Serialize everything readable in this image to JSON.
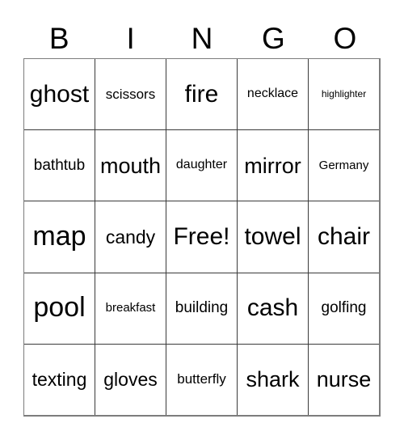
{
  "card": {
    "title": "BINGO",
    "header_letters": [
      "B",
      "I",
      "N",
      "G",
      "O"
    ],
    "free_space": "Free!",
    "colors": {
      "background": "#ffffff",
      "text": "#000000",
      "outer_border": "#7d7d7d",
      "inner_border": "#3a3a3a"
    },
    "rows": [
      [
        {
          "label": "ghost",
          "size": "s-xxl"
        },
        {
          "label": "scissors",
          "size": "s-md"
        },
        {
          "label": "fire",
          "size": "s-xxl"
        },
        {
          "label": "necklace",
          "size": "s-smm"
        },
        {
          "label": "highlighter",
          "size": "s-xs"
        }
      ],
      [
        {
          "label": "bathtub",
          "size": "s-mdl"
        },
        {
          "label": "mouth",
          "size": "s-xl"
        },
        {
          "label": "daughter",
          "size": "s-smm"
        },
        {
          "label": "mirror",
          "size": "s-xl"
        },
        {
          "label": "Germany",
          "size": "s-sm"
        }
      ],
      [
        {
          "label": "map",
          "size": "s-max"
        },
        {
          "label": "candy",
          "size": "s-lg"
        },
        {
          "label": "Free!",
          "size": "s-xxl"
        },
        {
          "label": "towel",
          "size": "s-xxl"
        },
        {
          "label": "chair",
          "size": "s-xxl"
        }
      ],
      [
        {
          "label": "pool",
          "size": "s-max"
        },
        {
          "label": "breakfast",
          "size": "s-sm"
        },
        {
          "label": "building",
          "size": "s-mdl"
        },
        {
          "label": "cash",
          "size": "s-xxl"
        },
        {
          "label": "golfing",
          "size": "s-mdl"
        }
      ],
      [
        {
          "label": "texting",
          "size": "s-lg"
        },
        {
          "label": "gloves",
          "size": "s-lg"
        },
        {
          "label": "butterfly",
          "size": "s-md"
        },
        {
          "label": "shark",
          "size": "s-xl"
        },
        {
          "label": "nurse",
          "size": "s-xl"
        }
      ]
    ]
  }
}
